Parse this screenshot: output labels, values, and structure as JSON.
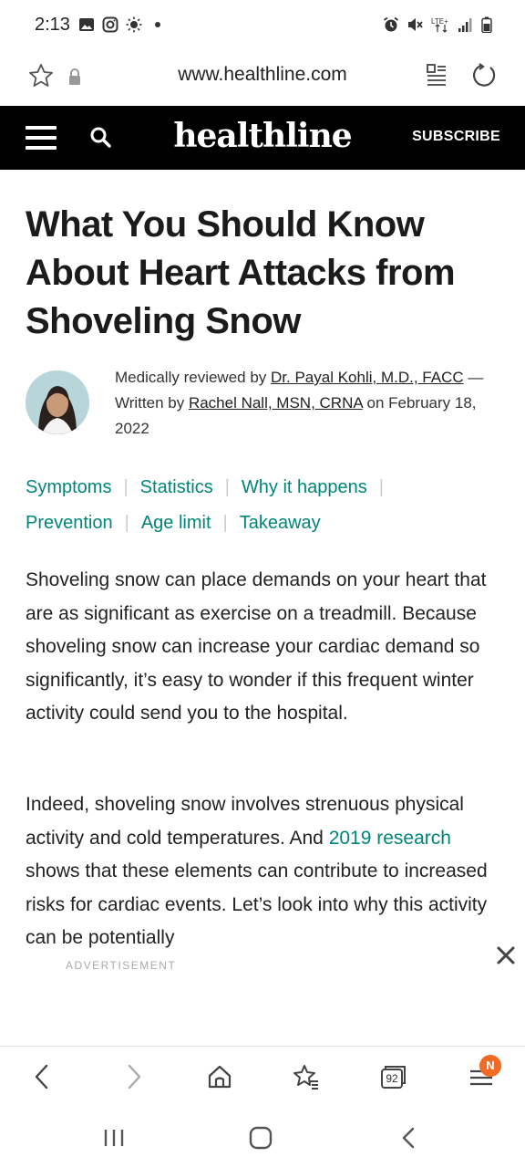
{
  "status": {
    "time": "2:13",
    "left_icons": [
      "gallery-icon",
      "instagram-icon",
      "brightness-icon",
      "dot-icon"
    ],
    "right_icons": [
      "alarm-icon",
      "mute-icon",
      "lte-icon",
      "signal-icon",
      "battery-icon"
    ]
  },
  "browser": {
    "url": "www.healthline.com",
    "tab_count": "92",
    "notification_badge": "N"
  },
  "site": {
    "brand": "healthline",
    "subscribe_label": "SUBSCRIBE"
  },
  "article": {
    "title": "What You Should Know About Heart Attacks from Shoveling Snow",
    "byline": {
      "reviewed_prefix": "Medically reviewed by ",
      "reviewer": "Dr. Payal Kohli, M.D., FACC",
      "written_prefix": " — Written by ",
      "author": "Rachel Nall, MSN, CRNA",
      "on": " on ",
      "date": "February 18, 2022"
    },
    "toc": [
      "Symptoms",
      "Statistics",
      "Why it happens",
      "Prevention",
      "Age limit",
      "Takeaway"
    ],
    "para1": "Shoveling snow can place demands on your heart that are as significant as exercise on a treadmill. Because shoveling snow can increase your cardiac demand so significantly, it’s easy to wonder if this frequent winter activity could send you to the hospital.",
    "para2_start": "Indeed, shoveling snow involves strenuous physical activity and cold temperatures. And ",
    "para2_link": "2019 research",
    "para2_end": " shows that these elements can contribute to increased risks for cardiac events. Let’s look into why this activity can be potentially"
  },
  "ad": {
    "label": "ADVERTISEMENT"
  },
  "colors": {
    "accent": "#00857a",
    "header_bg": "#000000",
    "badge": "#f26b24"
  }
}
